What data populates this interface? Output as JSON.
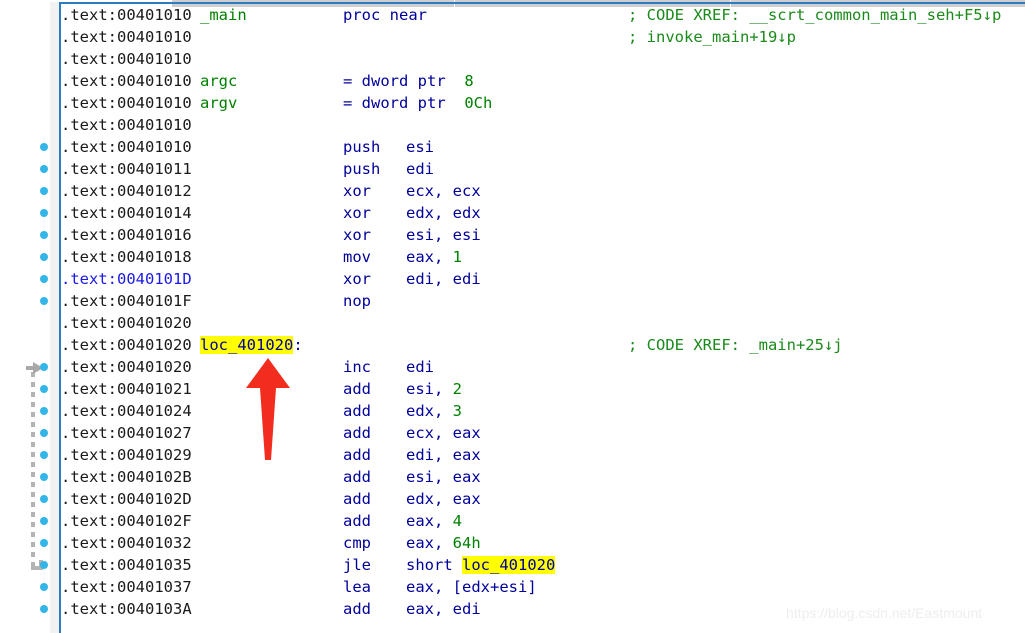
{
  "app": {
    "title": "IDA Pro Disassembly View",
    "watermark": "https://blog.csdn.net/Eastmount"
  },
  "colors": {
    "address": "#1a1a1a",
    "current_address": "#1a1ae6",
    "mnemonic": "#00009b",
    "operand": "#00009b",
    "number": "#008000",
    "local_name": "#008000",
    "comment": "#1a8a1a",
    "highlight": "#ffff00",
    "gutter_dot": "#33b5e8",
    "jump_line": "#b4b4b4",
    "border": "#2b7cc0",
    "annotation_arrow": "#f22d1e"
  },
  "annotation": {
    "red_arrow": {
      "points_to": "loc_401020",
      "direction": "up"
    }
  },
  "jump_arrow": {
    "from_line_index": 24,
    "to_line_index": 15,
    "style": "dashed"
  },
  "listing": {
    "segment": ".text",
    "lines": [
      {
        "addr": ".text:00401010",
        "label": "_main",
        "mnem": "",
        "ops": "",
        "kw": "proc near",
        "cmt": "; CODE XREF: __scrt_common_main_seh+F5↓p",
        "dot": false,
        "current": false
      },
      {
        "addr": ".text:00401010",
        "label": "",
        "mnem": "",
        "ops": "",
        "kw": "",
        "cmt": "; invoke_main+19↓p",
        "dot": false,
        "current": false
      },
      {
        "addr": ".text:00401010",
        "label": "",
        "mnem": "",
        "ops": "",
        "kw": "",
        "cmt": "",
        "dot": false,
        "current": false
      },
      {
        "addr": ".text:00401010",
        "label": "argc",
        "mnem": "",
        "ops": "",
        "kw": "= dword ptr",
        "num": "8",
        "cmt": "",
        "dot": false,
        "current": false
      },
      {
        "addr": ".text:00401010",
        "label": "argv",
        "mnem": "",
        "ops": "",
        "kw": "= dword ptr",
        "num": "0Ch",
        "cmt": "",
        "dot": false,
        "current": false
      },
      {
        "addr": ".text:00401010",
        "label": "",
        "mnem": "",
        "ops": "",
        "kw": "",
        "cmt": "",
        "dot": false,
        "current": false
      },
      {
        "addr": ".text:00401010",
        "label": "",
        "mnem": "push",
        "ops": "esi",
        "kw": "",
        "cmt": "",
        "dot": true,
        "current": false
      },
      {
        "addr": ".text:00401011",
        "label": "",
        "mnem": "push",
        "ops": "edi",
        "kw": "",
        "cmt": "",
        "dot": true,
        "current": false
      },
      {
        "addr": ".text:00401012",
        "label": "",
        "mnem": "xor",
        "ops": "ecx, ecx",
        "kw": "",
        "cmt": "",
        "dot": true,
        "current": false
      },
      {
        "addr": ".text:00401014",
        "label": "",
        "mnem": "xor",
        "ops": "edx, edx",
        "kw": "",
        "cmt": "",
        "dot": true,
        "current": false
      },
      {
        "addr": ".text:00401016",
        "label": "",
        "mnem": "xor",
        "ops": "esi, esi",
        "kw": "",
        "cmt": "",
        "dot": true,
        "current": false
      },
      {
        "addr": ".text:00401018",
        "label": "",
        "mnem": "mov",
        "ops": "eax, ",
        "num": "1",
        "kw": "",
        "cmt": "",
        "dot": true,
        "current": false
      },
      {
        "addr": ".text:0040101D",
        "label": "",
        "mnem": "xor",
        "ops": "edi, edi",
        "kw": "",
        "cmt": "",
        "dot": true,
        "current": true
      },
      {
        "addr": ".text:0040101F",
        "label": "",
        "mnem": "nop",
        "ops": "",
        "kw": "",
        "cmt": "",
        "dot": true,
        "current": false
      },
      {
        "addr": ".text:00401020",
        "label": "",
        "mnem": "",
        "ops": "",
        "kw": "",
        "cmt": "",
        "dot": false,
        "current": false
      },
      {
        "addr": ".text:00401020",
        "label": "loc_401020",
        "label_highlight": true,
        "label_suffix": ":",
        "mnem": "",
        "ops": "",
        "kw": "",
        "cmt": "; CODE XREF: _main+25↓j",
        "dot": false,
        "current": false
      },
      {
        "addr": ".text:00401020",
        "label": "",
        "mnem": "inc",
        "ops": "edi",
        "kw": "",
        "cmt": "",
        "dot": true,
        "current": false
      },
      {
        "addr": ".text:00401021",
        "label": "",
        "mnem": "add",
        "ops": "esi, ",
        "num": "2",
        "kw": "",
        "cmt": "",
        "dot": true,
        "current": false
      },
      {
        "addr": ".text:00401024",
        "label": "",
        "mnem": "add",
        "ops": "edx, ",
        "num": "3",
        "kw": "",
        "cmt": "",
        "dot": true,
        "current": false
      },
      {
        "addr": ".text:00401027",
        "label": "",
        "mnem": "add",
        "ops": "ecx, eax",
        "kw": "",
        "cmt": "",
        "dot": true,
        "current": false
      },
      {
        "addr": ".text:00401029",
        "label": "",
        "mnem": "add",
        "ops": "edi, eax",
        "kw": "",
        "cmt": "",
        "dot": true,
        "current": false
      },
      {
        "addr": ".text:0040102B",
        "label": "",
        "mnem": "add",
        "ops": "esi, eax",
        "kw": "",
        "cmt": "",
        "dot": true,
        "current": false
      },
      {
        "addr": ".text:0040102D",
        "label": "",
        "mnem": "add",
        "ops": "edx, eax",
        "kw": "",
        "cmt": "",
        "dot": true,
        "current": false
      },
      {
        "addr": ".text:0040102F",
        "label": "",
        "mnem": "add",
        "ops": "eax, ",
        "num": "4",
        "kw": "",
        "cmt": "",
        "dot": true,
        "current": false
      },
      {
        "addr": ".text:00401032",
        "label": "",
        "mnem": "cmp",
        "ops": "eax, ",
        "num": "64h",
        "kw": "",
        "cmt": "",
        "dot": true,
        "current": false
      },
      {
        "addr": ".text:00401035",
        "label": "",
        "mnem": "jle",
        "ops": "short ",
        "ref": "loc_401020",
        "ref_highlight": true,
        "kw": "",
        "cmt": "",
        "dot": true,
        "current": false
      },
      {
        "addr": ".text:00401037",
        "label": "",
        "mnem": "lea",
        "ops": "eax, [edx+esi]",
        "kw": "",
        "cmt": "",
        "dot": true,
        "current": false
      },
      {
        "addr": ".text:0040103A",
        "label": "",
        "mnem": "add",
        "ops": "eax, edi",
        "kw": "",
        "cmt": "",
        "dot": true,
        "current": false
      }
    ]
  }
}
